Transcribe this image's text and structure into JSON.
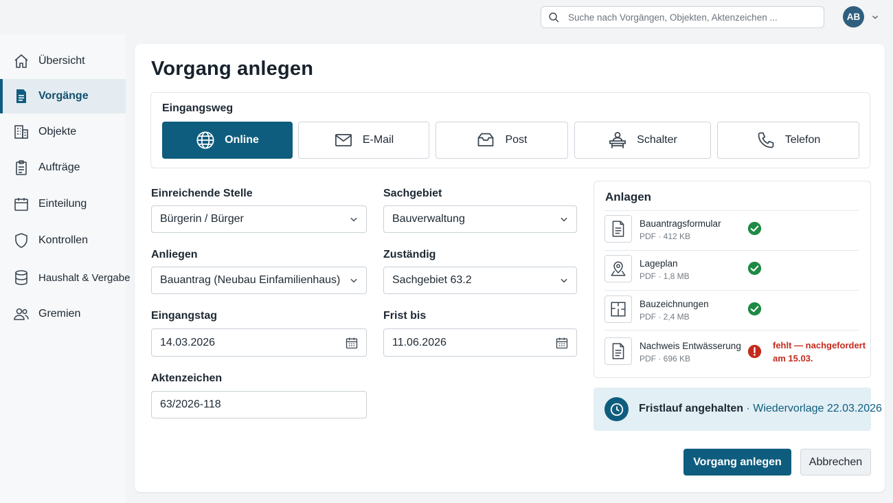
{
  "header": {
    "search_placeholder": "Suche nach Vorgängen, Objekten, Aktenzeichen ...",
    "avatar_initials": "AB"
  },
  "sidebar": {
    "items": [
      {
        "label": "Übersicht",
        "icon": "home-icon"
      },
      {
        "label": "Vorgänge",
        "icon": "document-icon",
        "active": true
      },
      {
        "label": "Objekte",
        "icon": "building-icon"
      },
      {
        "label": "Aufträge",
        "icon": "clipboard-icon"
      },
      {
        "label": "Einteilung",
        "icon": "calendar-icon"
      },
      {
        "label": "Kontrollen",
        "icon": "shield-icon"
      },
      {
        "label": "Haushalt & Vergabe",
        "icon": "database-icon"
      },
      {
        "label": "Gremien",
        "icon": "users-icon"
      }
    ]
  },
  "main": {
    "title": "Vorgang anlegen",
    "eingangsweg": {
      "label": "Eingangsweg",
      "options": [
        "Online",
        "E-Mail",
        "Post",
        "Schalter",
        "Telefon"
      ],
      "selected": "Online"
    },
    "form": {
      "einreichende_stelle": {
        "label": "Einreichende Stelle",
        "value": "Bürgerin / Bürger"
      },
      "sachgebiet": {
        "label": "Sachgebiet",
        "value": "Bauverwaltung"
      },
      "anliegen": {
        "label": "Anliegen",
        "value": "Bauantrag (Neubau Einfamilienhaus)"
      },
      "zustaendig": {
        "label": "Zuständig",
        "value": "Sachgebiet 63.2"
      },
      "eingangstag": {
        "label": "Eingangstag",
        "value": "14.03.2026"
      },
      "frist_bis": {
        "label": "Frist bis",
        "value": "11.06.2026"
      },
      "aktenzeichen": {
        "label": "Aktenzeichen",
        "value": "63/2026-118"
      }
    },
    "anlagen": {
      "title": "Anlagen",
      "items": [
        {
          "name": "Bauantragsformular",
          "meta": "PDF · 412 KB",
          "status": "ok",
          "icon": "document-icon"
        },
        {
          "name": "Lageplan",
          "meta": "PDF · 1,8 MB",
          "status": "ok",
          "icon": "map-pin-icon"
        },
        {
          "name": "Bauzeichnungen",
          "meta": "PDF · 2,4 MB",
          "status": "ok",
          "icon": "floorplan-icon"
        },
        {
          "name": "Nachweis Entwässerung",
          "meta": "PDF · 696 KB",
          "status": "missing",
          "status_text": "fehlt — nachgefordert am 15.03.",
          "icon": "document-icon"
        }
      ]
    },
    "fristlauf": {
      "label": "Fristlauf angehalten",
      "separator": " · ",
      "detail": "Wiedervorlage 22.03.2026"
    },
    "actions": {
      "primary": "Vorgang anlegen",
      "secondary": "Abbrechen"
    }
  },
  "colors": {
    "primary": "#0f5d7e",
    "success": "#1e8a45",
    "error": "#c42a1c",
    "info_bg": "#e2eff4"
  }
}
